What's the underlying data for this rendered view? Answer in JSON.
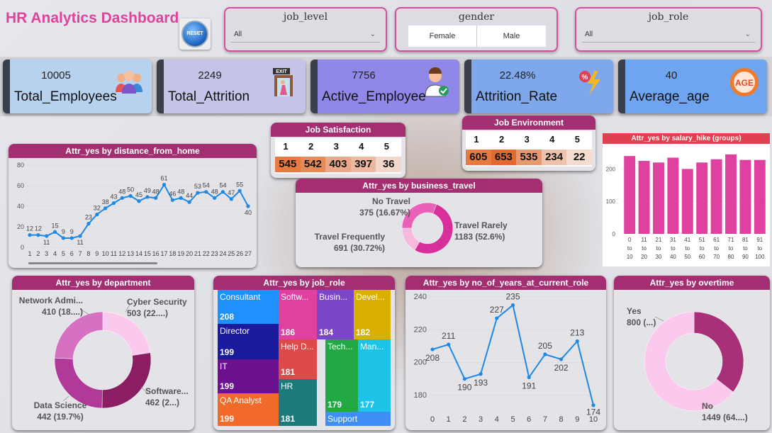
{
  "header": {
    "title": "HR Analytics Dashboard",
    "reset_label": "RESET"
  },
  "filters": {
    "job_level": {
      "title": "job_level",
      "value": "All"
    },
    "gender": {
      "title": "gender",
      "options": [
        "Female",
        "Male"
      ]
    },
    "job_role": {
      "title": "job_role",
      "value": "All"
    }
  },
  "kpis": [
    {
      "value": "10005",
      "label": "Total_Employees",
      "color": "#b7d2ef"
    },
    {
      "value": "2249",
      "label": "Total_Attrition",
      "color": "#c5c3e7"
    },
    {
      "value": "7756",
      "label": "Active_Employee",
      "color": "#8f88e8"
    },
    {
      "value": "22.48%",
      "label": "Attrition_Rate",
      "color": "#7fa8ec"
    },
    {
      "value": "40",
      "label": "Average_age",
      "color": "#6ea4f0"
    }
  ],
  "icons": {
    "employees": "people-group-icon",
    "attrition": "exit-door-icon",
    "active": "doctor-check-icon",
    "rate": "lightning-percent-icon",
    "age": "age-badge-icon"
  },
  "job_satisfaction": {
    "title": "Job Satisfaction",
    "headers": [
      "1",
      "2",
      "3",
      "4",
      "5"
    ],
    "values": [
      "545",
      "542",
      "403",
      "397",
      "36"
    ],
    "colors": [
      "#e67a40",
      "#e68a58",
      "#e9a88a",
      "#ecb8a0",
      "#f2d8cc"
    ]
  },
  "job_environment": {
    "title": "Job Environment",
    "headers": [
      "1",
      "2",
      "3",
      "4",
      "5"
    ],
    "values": [
      "605",
      "653",
      "535",
      "234",
      "22"
    ],
    "colors": [
      "#e67a40",
      "#e26a30",
      "#e99970",
      "#efc2ae",
      "#f4dcd0"
    ]
  },
  "charts": {
    "distance": {
      "title": "Attr_yes by distance_from_home"
    },
    "salary": {
      "title": "Attr_yes by salary_hike (groups)"
    },
    "business": {
      "title": "Attr_yes by business_travel",
      "labels": [
        {
          "name": "No Travel",
          "value": "375 (16.67%)"
        },
        {
          "name": "Travel Frequently",
          "value": "691 (30.72%)"
        },
        {
          "name": "Travel Rarely",
          "value": "1183 (52.6%)"
        }
      ]
    },
    "department": {
      "title": "Attr_yes by department",
      "labels": [
        {
          "name": "Network Admi...",
          "value": "410 (18....)"
        },
        {
          "name": "Cyber Security",
          "value": "503 (22....)"
        },
        {
          "name": "Software...",
          "value": "462 (2...)"
        },
        {
          "name": "Data Science",
          "value": "442 (19.7%)"
        }
      ]
    },
    "jobrole": {
      "title": "Attr_yes by job_role"
    },
    "years": {
      "title": "Attr_yes by no_of_years_at_current_role"
    },
    "overtime": {
      "title": "Attr_yes by overtime",
      "labels": [
        {
          "name": "Yes",
          "value": "800 (...)"
        },
        {
          "name": "No",
          "value": "1449 (64....)"
        }
      ]
    }
  },
  "chart_data": [
    {
      "type": "line",
      "title": "Attr_yes by distance_from_home",
      "x": [
        1,
        2,
        3,
        4,
        5,
        6,
        7,
        8,
        9,
        10,
        11,
        12,
        13,
        14,
        15,
        16,
        17,
        18,
        19,
        20,
        21,
        22,
        23,
        24,
        25,
        26,
        27
      ],
      "values": [
        12,
        12,
        11,
        15,
        9,
        9,
        11,
        23,
        32,
        38,
        43,
        48,
        50,
        45,
        49,
        48,
        61,
        46,
        48,
        44,
        53,
        54,
        48,
        54,
        47,
        55,
        40
      ],
      "ylim": [
        0,
        80
      ],
      "yticks": [
        0,
        20,
        40,
        60,
        80
      ],
      "color": "#1e88e5"
    },
    {
      "type": "bar",
      "title": "Attr_yes by salary_hike (groups)",
      "categories": [
        "0 to 10",
        "11 to 20",
        "21 to 30",
        "31 to 40",
        "41 to 50",
        "51 to 60",
        "61 to 70",
        "71 to 80",
        "81 to 90",
        "91 to 100"
      ],
      "values": [
        240,
        225,
        220,
        235,
        200,
        220,
        230,
        245,
        228,
        228
      ],
      "ylim": [
        0,
        260
      ],
      "yticks": [
        0,
        100,
        200
      ],
      "color": "#e040a0"
    },
    {
      "type": "pie",
      "title": "Attr_yes by business_travel",
      "labels": [
        "No Travel",
        "Travel Frequently",
        "Travel Rarely"
      ],
      "values": [
        375,
        691,
        1183
      ],
      "colors": [
        "#f7b9dd",
        "#e860b8",
        "#d8309a"
      ]
    },
    {
      "type": "pie",
      "title": "Attr_yes by department",
      "labels": [
        "Network Admi...",
        "Cyber Security",
        "Software...",
        "Data Science"
      ],
      "values": [
        410,
        503,
        462,
        442
      ],
      "colors": [
        "#fbc9ee",
        "#8b1e63",
        "#b0399a",
        "#d670c0"
      ]
    },
    {
      "type": "table",
      "title": "Attr_yes by job_role",
      "categories": [
        "Consultant",
        "Director",
        "IT",
        "QA Analyst",
        "Softw...",
        "Help D...",
        "HR",
        "Busin...",
        "Devel...",
        "Tech...",
        "Man...",
        "Support"
      ],
      "values": [
        208,
        199,
        199,
        199,
        186,
        181,
        181,
        184,
        182,
        179,
        177,
        null
      ],
      "colors": [
        "#1e90ff",
        "#1a1a9c",
        "#6b108f",
        "#f26a2a",
        "#e040a0",
        "#dc4a4a",
        "#1d7a7a",
        "#7b46c9",
        "#d9b000",
        "#22a845",
        "#1dc4e8",
        "#3d8ef5"
      ]
    },
    {
      "type": "line",
      "title": "Attr_yes by no_of_years_at_current_role",
      "x": [
        0,
        1,
        2,
        3,
        4,
        5,
        6,
        7,
        8,
        9,
        10
      ],
      "values": [
        208,
        211,
        190,
        193,
        227,
        235,
        191,
        205,
        202,
        213,
        174
      ],
      "ylim": [
        170,
        240
      ],
      "yticks": [
        180,
        200,
        220,
        240
      ],
      "color": "#1e88e5"
    },
    {
      "type": "pie",
      "title": "Attr_yes by overtime",
      "labels": [
        "Yes",
        "No"
      ],
      "values": [
        800,
        1449
      ],
      "colors": [
        "#a83078",
        "#fbc9ee"
      ]
    }
  ]
}
